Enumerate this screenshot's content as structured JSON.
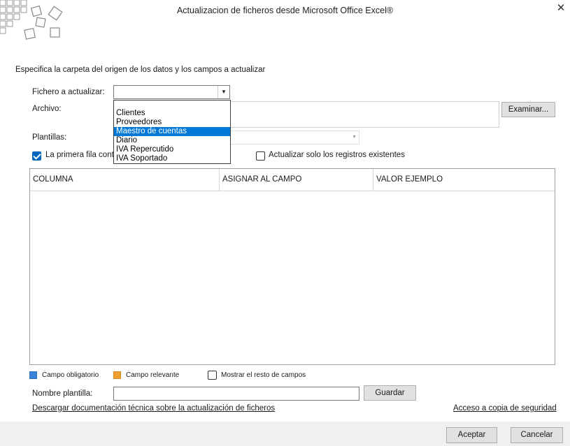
{
  "window": {
    "title": "Actualizacion de ficheros desde Microsoft Office Excel®",
    "close_glyph": "✕"
  },
  "subtitle": "Especifica la carpeta del origen de los datos y los campos a actualizar",
  "form": {
    "fichero_label": "Fichero a actualizar:",
    "fichero_value": "",
    "archivo_label": "Archivo:",
    "archivo_value": "",
    "examinar_label": "Examinar...",
    "plantillas_label": "Plantillas:",
    "plantillas_value": "",
    "primera_fila_label": "La primera fila cont",
    "primera_fila_checked": true,
    "solo_existentes_label": "Actualizar solo los registros existentes",
    "solo_existentes_checked": false
  },
  "dropdown": {
    "open": true,
    "options": [
      "Clientes",
      "Proveedores",
      "Maestro de cuentas",
      "Diario",
      "IVA Repercutido",
      "IVA Soportado"
    ],
    "selected_index": 2
  },
  "grid": {
    "columns": [
      "COLUMNA",
      "ASIGNAR AL CAMPO",
      "VALOR EJEMPLO"
    ],
    "rows": []
  },
  "legend": {
    "obligatorio_label": "Campo obligatorio",
    "obligatorio_color": "#3b82d8",
    "relevante_label": "Campo relevante",
    "relevante_color": "#f0a030",
    "mostrar_resto_label": "Mostrar el resto de campos",
    "mostrar_resto_checked": false
  },
  "nombre_plantilla": {
    "label": "Nombre plantilla:",
    "value": "",
    "guardar_label": "Guardar"
  },
  "links": {
    "documentacion": "Descargar documentación técnica sobre la actualización de ficheros",
    "copia_seguridad": "Acceso a copia de seguridad"
  },
  "footer": {
    "aceptar_label": "Aceptar",
    "cancelar_label": "Cancelar"
  }
}
